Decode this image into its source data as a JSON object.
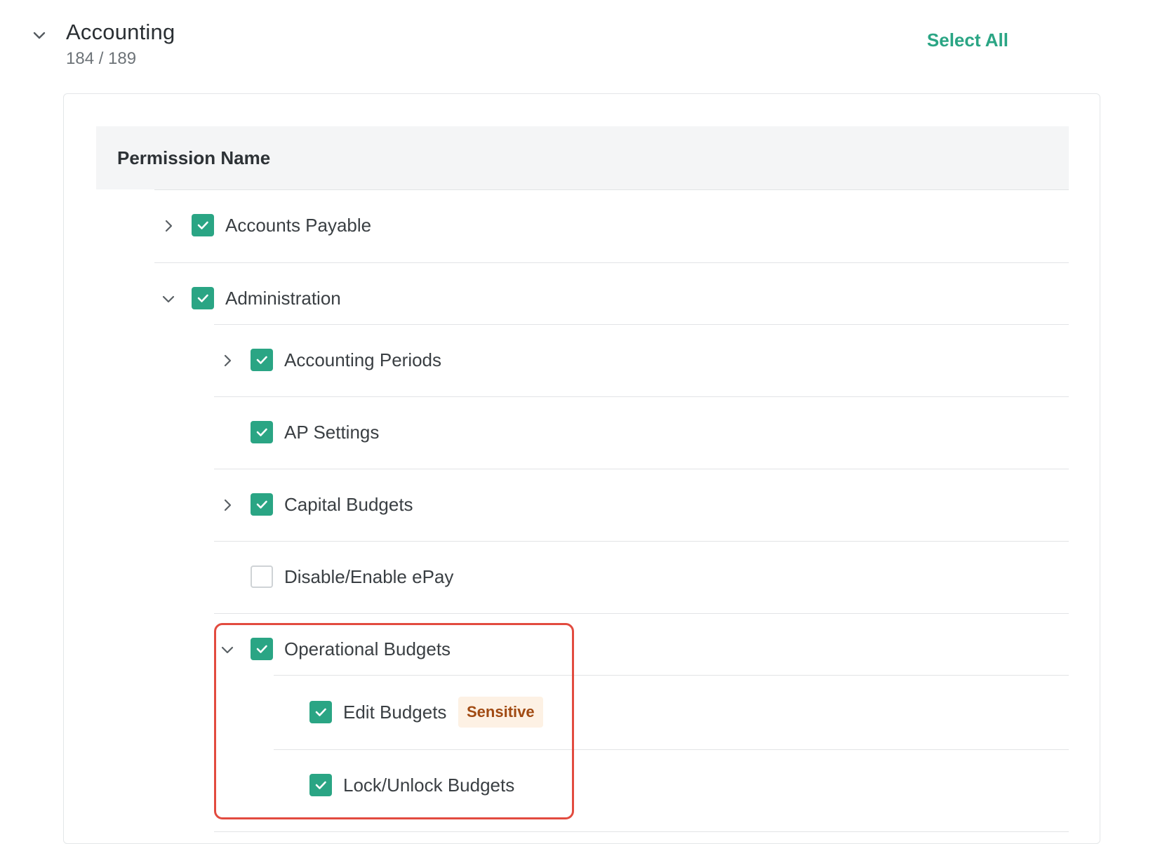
{
  "section": {
    "title": "Accounting",
    "count": "184 / 189",
    "select_all_label": "Select All",
    "chevron_icon": "chevron-down-icon"
  },
  "table": {
    "header_label": "Permission Name"
  },
  "rows": {
    "accounts_payable": {
      "label": "Accounts Payable",
      "checked": true,
      "expander": "chevron-right-icon"
    },
    "administration": {
      "label": "Administration",
      "checked": true,
      "expander": "chevron-down-icon"
    },
    "accounting_periods": {
      "label": "Accounting Periods",
      "checked": true,
      "expander": "chevron-right-icon"
    },
    "ap_settings": {
      "label": "AP Settings",
      "checked": true
    },
    "capital_budgets": {
      "label": "Capital Budgets",
      "checked": true,
      "expander": "chevron-right-icon"
    },
    "disable_enable_epay": {
      "label": "Disable/Enable ePay",
      "checked": false
    },
    "operational_budgets": {
      "label": "Operational Budgets",
      "checked": true,
      "expander": "chevron-down-icon"
    },
    "edit_budgets": {
      "label": "Edit Budgets",
      "checked": true,
      "badge": "Sensitive"
    },
    "lock_unlock_budgets": {
      "label": "Lock/Unlock Budgets",
      "checked": true
    }
  },
  "colors": {
    "accent_green": "#2aa584",
    "sensitive_badge_bg": "#fdf1e4",
    "sensitive_badge_text": "#a14a12",
    "highlight_border": "#e24b3f"
  }
}
